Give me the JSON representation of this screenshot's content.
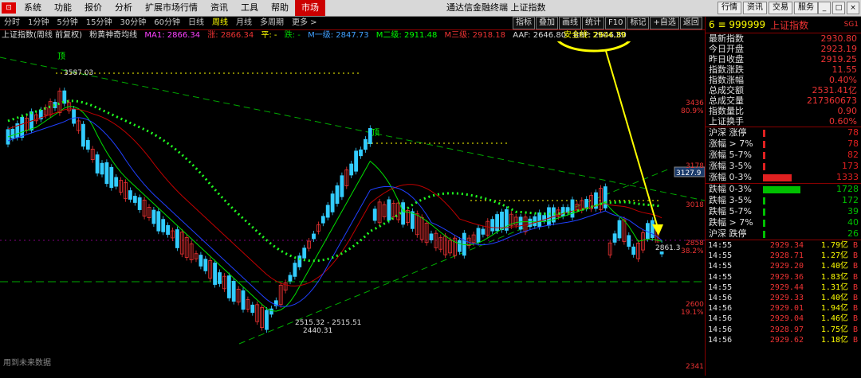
{
  "menu": {
    "items": [
      "系统",
      "功能",
      "报价",
      "分析",
      "扩展市场行情",
      "资讯",
      "工具",
      "帮助"
    ],
    "active": "市场",
    "window_title": "通达信金融终端 上证指数",
    "right_buttons": [
      "行情",
      "资讯",
      "交易",
      "服务"
    ]
  },
  "tabs": [
    "分时",
    "1分钟",
    "5分钟",
    "15分钟",
    "30分钟",
    "60分钟",
    "日线",
    "周线",
    "月线",
    "多周期",
    "更多 >"
  ],
  "active_tab": "周线",
  "tools": [
    "指标",
    "叠加",
    "画线",
    "统计",
    "F10",
    "标记",
    "+自选",
    "返回"
  ],
  "info": {
    "title": "上证指数(周线 前复权)",
    "indicator": "粉黄神奇均线",
    "ma1": "MA1: 2866.34",
    "zhang": "涨: 2866.34",
    "ping": "平: -",
    "die": "跌: -",
    "m1": "M一级: 2847.73",
    "m2": "M二级: 2911.48",
    "m3": "M三级: 2918.18",
    "aaf": "AAF: 2646.80",
    "bbf": "BBF: 2646.80",
    "safe_label": "安全线: 2904.39",
    "safe_tag": "安全线"
  },
  "axis": {
    "levels": [
      {
        "price": "3436",
        "pct": "80.9%"
      },
      {
        "price": "3178",
        "pct": ""
      },
      {
        "price": "3018",
        "pct": ""
      },
      {
        "price": "2858",
        "pct": "38.2%"
      },
      {
        "price": "2600",
        "pct": "19.1%"
      },
      {
        "price": "2341",
        "pct": ""
      }
    ],
    "cursor_price": "3127.9",
    "last_price": "2861.3"
  },
  "annotations": {
    "high": "3587.03",
    "low": "2440.31",
    "range": "2515.32 - 2515.51",
    "label_top": "顶",
    "label_mid": "顶"
  },
  "watermark": "用到未来数据",
  "quote": {
    "code": "6 ≡ 999999",
    "name": "上证指数",
    "tag": "SG1",
    "rows": [
      {
        "label": "最新指数",
        "value": "2930.80"
      },
      {
        "label": "今日开盘",
        "value": "2923.19"
      },
      {
        "label": "昨日收盘",
        "value": "2919.25"
      },
      {
        "label": "指数涨跌",
        "value": "11.55"
      },
      {
        "label": "指数涨幅",
        "value": "0.40%"
      },
      {
        "label": "总成交额",
        "value": "2531.41亿"
      },
      {
        "label": "总成交量",
        "value": "217360673"
      },
      {
        "label": "指数量比",
        "value": "0.90"
      },
      {
        "label": "上证换手",
        "value": "0.60%"
      }
    ]
  },
  "breadth": {
    "up": [
      {
        "label": "沪深 涨停",
        "count": "78",
        "fill": 0.02
      },
      {
        "label": "涨幅 > 7%",
        "count": "78",
        "fill": 0.02
      },
      {
        "label": "涨幅 5-7%",
        "count": "82",
        "fill": 0.02
      },
      {
        "label": "涨幅 3-5%",
        "count": "173",
        "fill": 0.03
      },
      {
        "label": "涨幅 0-3%",
        "count": "1333",
        "fill": 0.33
      }
    ],
    "down": [
      {
        "label": "跌幅 0-3%",
        "count": "1728",
        "fill": 0.43
      },
      {
        "label": "跌幅 3-5%",
        "count": "172",
        "fill": 0.03
      },
      {
        "label": "跌幅 5-7%",
        "count": "39",
        "fill": 0.01
      },
      {
        "label": "跌幅 > 7%",
        "count": "40",
        "fill": 0.01
      },
      {
        "label": "沪深 跌停",
        "count": "26",
        "fill": 0.01
      }
    ],
    "colors": {
      "up": "#e02020",
      "down": "#00c000"
    }
  },
  "ticks": [
    {
      "time": "14:55",
      "price": "2929.34",
      "vol": "1.79亿"
    },
    {
      "time": "14:55",
      "price": "2928.71",
      "vol": "1.27亿"
    },
    {
      "time": "14:55",
      "price": "2929.20",
      "vol": "1.40亿"
    },
    {
      "time": "14:55",
      "price": "2929.36",
      "vol": "1.83亿"
    },
    {
      "time": "14:55",
      "price": "2929.44",
      "vol": "1.31亿"
    },
    {
      "time": "14:56",
      "price": "2929.33",
      "vol": "1.40亿"
    },
    {
      "time": "14:56",
      "price": "2929.01",
      "vol": "1.94亿"
    },
    {
      "time": "14:56",
      "price": "2929.04",
      "vol": "1.46亿"
    },
    {
      "time": "14:56",
      "price": "2928.97",
      "vol": "1.75亿"
    },
    {
      "time": "14:56",
      "price": "2929.62",
      "vol": "1.18亿"
    }
  ]
}
